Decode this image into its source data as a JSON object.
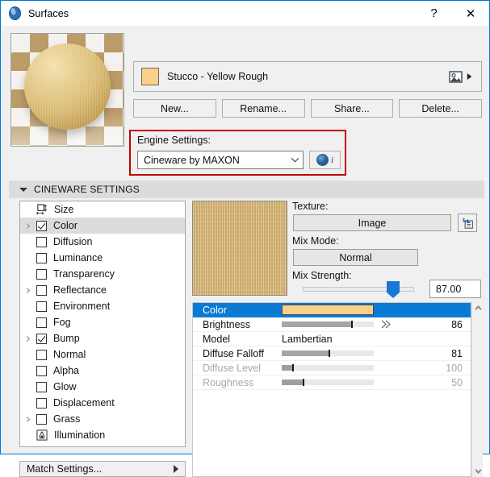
{
  "window": {
    "title": "Surfaces",
    "app_icon": "surfaces-sphere-icon",
    "help_label": "?",
    "close_label": "✕"
  },
  "material": {
    "preview_alt": "material-sphere-preview",
    "name": "Stucco - Yellow Rough",
    "swatch_color": "#fbd08a",
    "picker_icon": "image-picker-icon",
    "expand_arrow": "▶"
  },
  "buttons": {
    "new": "New...",
    "rename": "Rename...",
    "share": "Share...",
    "delete": "Delete..."
  },
  "engine": {
    "label": "Engine Settings:",
    "selected": "Cineware by MAXON",
    "options": [
      "Cineware by MAXON"
    ],
    "dropdown_arrow": "∨",
    "info_button": "engine-info-button",
    "highlight_color": "#c00000"
  },
  "section": {
    "caret": "▼",
    "title": "CINEWARE SETTINGS"
  },
  "channels": [
    {
      "label": "Size",
      "icon": "size-icon",
      "checkbox": false,
      "checked": false,
      "expandable": false,
      "selected": false
    },
    {
      "label": "Color",
      "icon": null,
      "checkbox": true,
      "checked": true,
      "expandable": true,
      "selected": true
    },
    {
      "label": "Diffusion",
      "icon": null,
      "checkbox": true,
      "checked": false,
      "expandable": false,
      "selected": false
    },
    {
      "label": "Luminance",
      "icon": null,
      "checkbox": true,
      "checked": false,
      "expandable": false,
      "selected": false
    },
    {
      "label": "Transparency",
      "icon": null,
      "checkbox": true,
      "checked": false,
      "expandable": false,
      "selected": false
    },
    {
      "label": "Reflectance",
      "icon": null,
      "checkbox": true,
      "checked": false,
      "expandable": true,
      "selected": false
    },
    {
      "label": "Environment",
      "icon": null,
      "checkbox": true,
      "checked": false,
      "expandable": false,
      "selected": false
    },
    {
      "label": "Fog",
      "icon": null,
      "checkbox": true,
      "checked": false,
      "expandable": false,
      "selected": false
    },
    {
      "label": "Bump",
      "icon": null,
      "checkbox": true,
      "checked": true,
      "expandable": true,
      "selected": false
    },
    {
      "label": "Normal",
      "icon": null,
      "checkbox": true,
      "checked": false,
      "expandable": false,
      "selected": false
    },
    {
      "label": "Alpha",
      "icon": null,
      "checkbox": true,
      "checked": false,
      "expandable": false,
      "selected": false
    },
    {
      "label": "Glow",
      "icon": null,
      "checkbox": true,
      "checked": false,
      "expandable": false,
      "selected": false
    },
    {
      "label": "Displacement",
      "icon": null,
      "checkbox": true,
      "checked": false,
      "expandable": false,
      "selected": false
    },
    {
      "label": "Grass",
      "icon": null,
      "checkbox": true,
      "checked": false,
      "expandable": true,
      "selected": false
    },
    {
      "label": "Illumination",
      "icon": "illumination-icon",
      "checkbox": false,
      "checked": false,
      "expandable": false,
      "selected": false
    }
  ],
  "match_settings": {
    "label": "Match Settings...",
    "arrow": "▶"
  },
  "texture": {
    "label": "Texture:",
    "value": "Image",
    "load_icon": "load-texture-icon"
  },
  "mix_mode": {
    "label": "Mix Mode:",
    "value": "Normal"
  },
  "mix_strength": {
    "label": "Mix Strength:",
    "value": "87.00",
    "percent": 81
  },
  "parameters": {
    "rows": [
      {
        "name": "Color",
        "type": "color",
        "value": "",
        "swatch": "#fbd08a",
        "selected": true,
        "dim": false,
        "fill": 0,
        "tick": 0,
        "arrows": false
      },
      {
        "name": "Brightness",
        "type": "slider",
        "value": "86",
        "swatch": null,
        "selected": false,
        "dim": false,
        "fill": 76,
        "tick": 76,
        "arrows": true
      },
      {
        "name": "Model",
        "type": "text",
        "value": "Lambertian",
        "swatch": null,
        "selected": false,
        "dim": false,
        "fill": 0,
        "tick": 0,
        "arrows": false
      },
      {
        "name": "Diffuse Falloff",
        "type": "slider",
        "value": "81",
        "swatch": null,
        "selected": false,
        "dim": false,
        "fill": 52,
        "tick": 52,
        "arrows": false
      },
      {
        "name": "Diffuse Level",
        "type": "slider",
        "value": "100",
        "swatch": null,
        "selected": false,
        "dim": true,
        "fill": 12,
        "tick": 12,
        "arrows": false
      },
      {
        "name": "Roughness",
        "type": "slider",
        "value": "50",
        "swatch": null,
        "selected": false,
        "dim": true,
        "fill": 24,
        "tick": 24,
        "arrows": false
      }
    ]
  },
  "scrollbar": {
    "up_arrow": "▲",
    "down_arrow": "▼"
  }
}
